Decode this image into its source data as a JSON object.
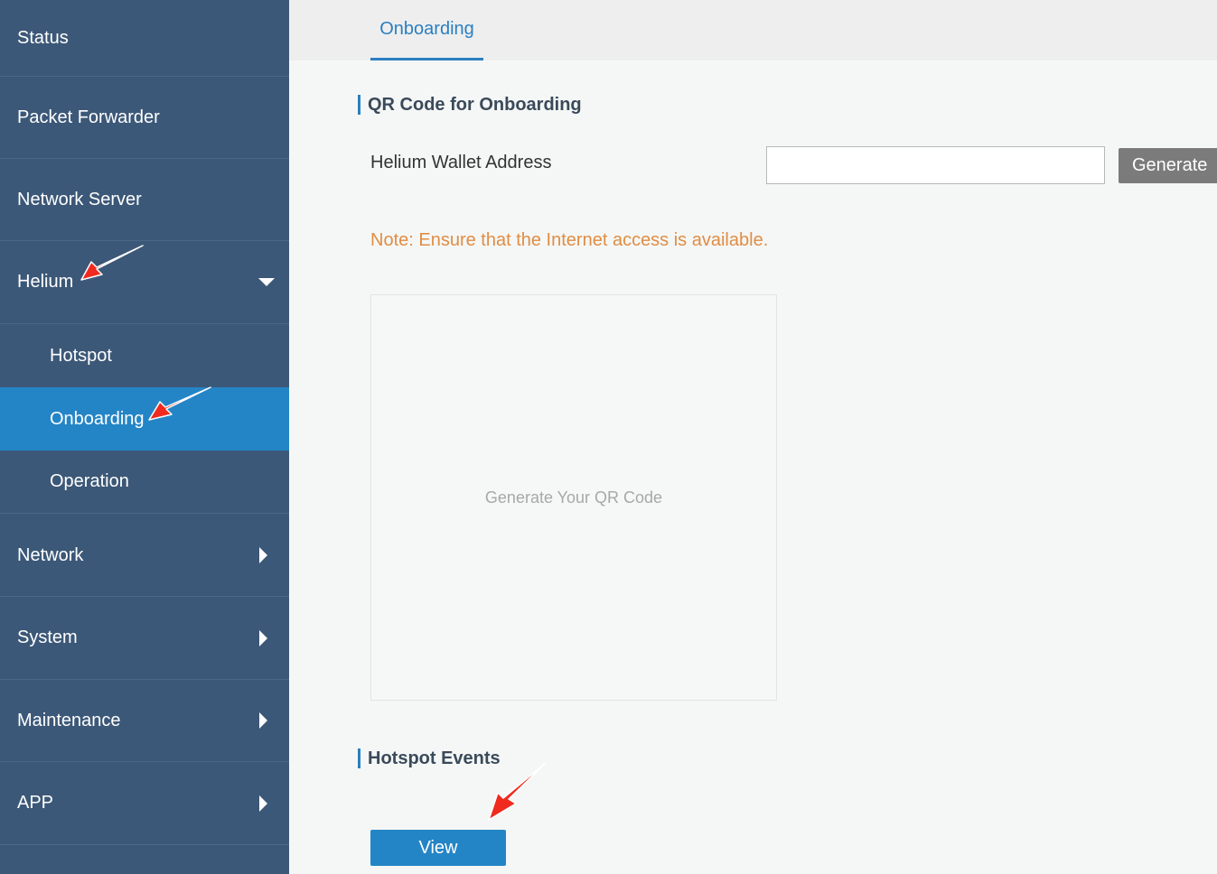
{
  "sidebar": {
    "items": [
      {
        "label": "Status"
      },
      {
        "label": "Packet Forwarder"
      },
      {
        "label": "Network Server"
      },
      {
        "label": "Helium"
      },
      {
        "label": "Hotspot"
      },
      {
        "label": "Onboarding"
      },
      {
        "label": "Operation"
      },
      {
        "label": "Network"
      },
      {
        "label": "System"
      },
      {
        "label": "Maintenance"
      },
      {
        "label": "APP"
      }
    ],
    "active_color": "#2485c6",
    "background": "#3c5878"
  },
  "tabs": [
    {
      "label": "Onboarding"
    }
  ],
  "qr_section": {
    "title": "QR Code for Onboarding",
    "wallet_label": "Helium Wallet Address",
    "wallet_value": "",
    "generate_label": "Generate",
    "note": "Note: Ensure that the Internet access is available.",
    "qr_placeholder": "Generate Your QR Code"
  },
  "events_section": {
    "title": "Hotspot Events",
    "view_label": "View"
  },
  "annotation_color": "#f02a1f"
}
